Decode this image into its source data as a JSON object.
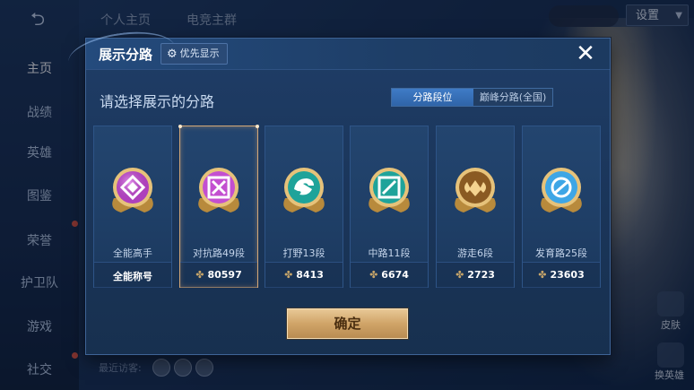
{
  "nav": {
    "items": [
      {
        "label": "主页",
        "active": true
      },
      {
        "label": "战绩",
        "active": false
      },
      {
        "label": "英雄",
        "active": false
      },
      {
        "label": "图鉴",
        "active": false
      },
      {
        "label": "荣誉",
        "active": false
      },
      {
        "label": "护卫队",
        "active": false
      },
      {
        "label": "游戏",
        "active": false
      },
      {
        "label": "社交",
        "active": false
      }
    ]
  },
  "top": {
    "tabs": [
      "个人主页",
      "电竞主群"
    ],
    "settings_label": "设置"
  },
  "recent_label": "最近访客:",
  "right_labels": {
    "a": "皮肤",
    "b": "换英雄"
  },
  "dialog": {
    "title": "展示分路",
    "priority_label": "优先显示",
    "subtitle": "请选择展示的分路",
    "segments": [
      "分路段位",
      "巅峰分路(全国)"
    ],
    "active_segment": 0,
    "confirm_label": "确定",
    "cards": [
      {
        "name": "全能高手",
        "score": "全能称号",
        "has_icon": false,
        "selected": false,
        "badge_color": "#c34fd0",
        "badge_symbol": "diamond"
      },
      {
        "name": "对抗路49段",
        "score": "80597",
        "has_icon": true,
        "selected": true,
        "badge_color": "#c34fd0",
        "badge_symbol": "x-square"
      },
      {
        "name": "打野13段",
        "score": "8413",
        "has_icon": true,
        "selected": false,
        "badge_color": "#1fa39a",
        "badge_symbol": "dragon"
      },
      {
        "name": "中路11段",
        "score": "6674",
        "has_icon": true,
        "selected": false,
        "badge_color": "#1fa39a",
        "badge_symbol": "slash-square"
      },
      {
        "name": "游走6段",
        "score": "2723",
        "has_icon": true,
        "selected": false,
        "badge_color": "#c79a4d",
        "badge_symbol": "wings"
      },
      {
        "name": "发育路25段",
        "score": "23603",
        "has_icon": true,
        "selected": false,
        "badge_color": "#3ea6e6",
        "badge_symbol": "target"
      }
    ]
  },
  "colors": {
    "gold": "#d0a468",
    "accent_blue": "#3f7bc6",
    "purple": "#c34fd0",
    "teal": "#1fa39a",
    "light_blue": "#3ea6e6"
  }
}
